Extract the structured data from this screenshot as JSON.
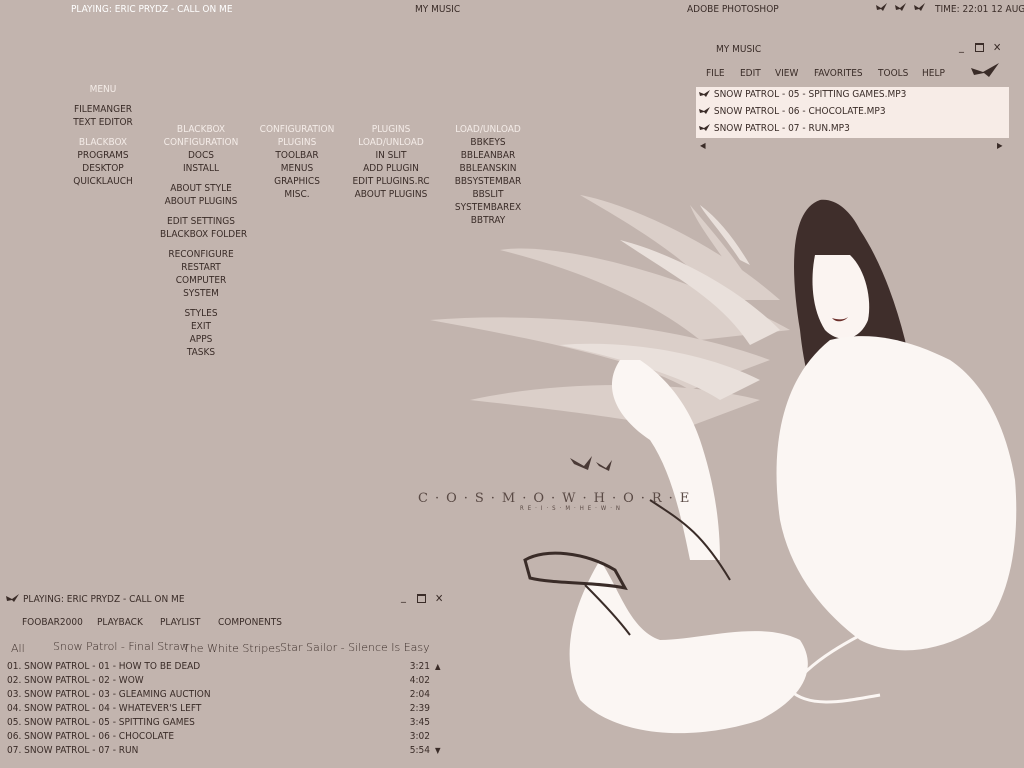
{
  "topbar": {
    "now_playing": "PLAYING: ERIC PRYDZ - CALL ON ME",
    "center": "MY MUSIC",
    "app": "ADOBE PHOTOSHOP",
    "time": "TIME: 22:01 12 AUG"
  },
  "menu": {
    "title": "MENU",
    "col1": {
      "items_a": [
        "FILEMANGER",
        "TEXT EDITOR"
      ],
      "header": "BLACKBOX",
      "items_b": [
        "PROGRAMS",
        "DESKTOP",
        "QUICKLAUCH"
      ]
    },
    "col2": {
      "header1": "BLACKBOX",
      "header2": "CONFIGURATION",
      "groups": [
        [
          "DOCS",
          "INSTALL"
        ],
        [
          "ABOUT STYLE",
          "ABOUT PLUGINS"
        ],
        [
          "EDIT SETTINGS",
          "BLACKBOX FOLDER"
        ],
        [
          "RECONFIGURE",
          "RESTART",
          "COMPUTER",
          "SYSTEM"
        ],
        [
          "STYLES",
          "EXIT",
          "APPS",
          "TASKS"
        ]
      ]
    },
    "col3": {
      "header1": "CONFIGURATION",
      "header2": "PLUGINS",
      "items": [
        "TOOLBAR",
        "MENUS",
        "GRAPHICS",
        "MISC."
      ]
    },
    "col4": {
      "header1": "PLUGINS",
      "header2": "LOAD/UNLOAD",
      "items": [
        "IN SLIT",
        "ADD PLUGIN",
        "EDIT PLUGINS.RC",
        "ABOUT PLUGINS"
      ]
    },
    "col5": {
      "header": "LOAD/UNLOAD",
      "items": [
        "BBKEYS",
        "BBLEANBAR",
        "BBLEANSKIN",
        "BBSYSTEMBAR",
        "BBSLIT",
        "SYSTEMBAREX",
        "BBTRAY"
      ]
    }
  },
  "mymusic": {
    "title": "MY MUSIC",
    "menu": [
      "FILE",
      "EDIT",
      "VIEW",
      "FAVORITES",
      "TOOLS",
      "HELP"
    ],
    "files": [
      "SNOW PATROL - 05 - SPITTING GAMES.MP3",
      "SNOW PATROL - 06 - CHOCOLATE.MP3",
      "SNOW PATROL - 07 - RUN.MP3"
    ]
  },
  "wallpaper": {
    "logo": "C·O·S·M·O·W·H·O·R·E",
    "logo_sub": "RE·I·S·M·HE·W·N"
  },
  "foobar": {
    "title": "PLAYING: ERIC PRYDZ - CALL ON ME",
    "menu": [
      "FOOBAR2000",
      "PLAYBACK",
      "PLAYLIST",
      "COMPONENTS"
    ],
    "tabs": [
      "All",
      "Snow Patrol - Final Straw",
      "The White Stripes",
      "Star Sailor - Silence Is Easy"
    ],
    "tracks": [
      {
        "name": "01. SNOW PATROL - 01 - HOW TO BE DEAD",
        "time": "3:21"
      },
      {
        "name": "02. SNOW PATROL - 02 - WOW",
        "time": "4:02"
      },
      {
        "name": "03. SNOW PATROL - 03 - GLEAMING AUCTION",
        "time": "2:04"
      },
      {
        "name": "04. SNOW PATROL - 04 - WHATEVER'S LEFT",
        "time": "2:39"
      },
      {
        "name": "05. SNOW PATROL - 05 - SPITTING GAMES",
        "time": "3:45"
      },
      {
        "name": "06. SNOW PATROL - 06 - CHOCOLATE",
        "time": "3:02"
      },
      {
        "name": "07. SNOW PATROL - 07 - RUN",
        "time": "5:54"
      }
    ]
  },
  "colors": {
    "background": "#c2b4ae",
    "text_dark": "#3a2c28",
    "text_light": "#f4ece8",
    "list_bg": "#f7ece7"
  }
}
